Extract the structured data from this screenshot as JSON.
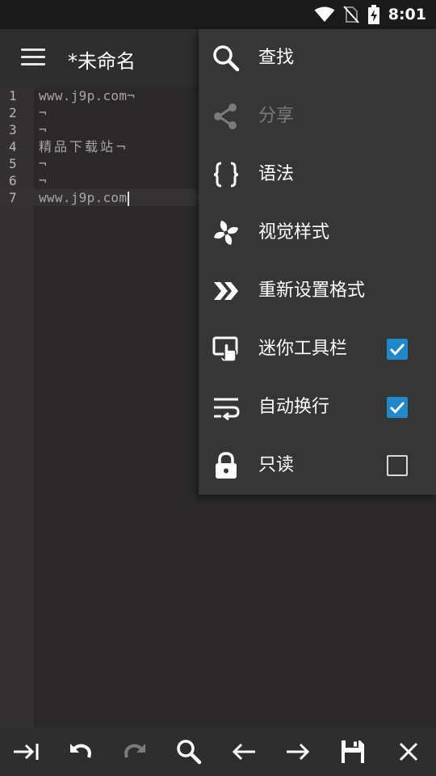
{
  "status_bar": {
    "time": "8:01",
    "icons": [
      "wifi-icon",
      "no-sim-icon",
      "battery-charging-icon"
    ]
  },
  "app_bar": {
    "menu_icon": "hamburger-icon",
    "title": "*未命名"
  },
  "editor": {
    "lines": [
      {
        "number": "1",
        "text": "www.j9p.com¬"
      },
      {
        "number": "2",
        "text": "¬"
      },
      {
        "number": "3",
        "text": "¬"
      },
      {
        "number": "4",
        "text": "精品下载站¬"
      },
      {
        "number": "5",
        "text": "¬"
      },
      {
        "number": "6",
        "text": "¬"
      },
      {
        "number": "7",
        "text": "www.j9p.com"
      }
    ],
    "active_line": 7
  },
  "menu": {
    "items": [
      {
        "label": "查找",
        "icon": "search-icon",
        "enabled": true
      },
      {
        "label": "分享",
        "icon": "share-icon",
        "enabled": false
      },
      {
        "label": "语法",
        "icon": "braces-icon",
        "enabled": true
      },
      {
        "label": "视觉样式",
        "icon": "pinwheel-icon",
        "enabled": true
      },
      {
        "label": "重新设置格式",
        "icon": "double-chevron-icon",
        "enabled": true
      },
      {
        "label": "迷你工具栏",
        "icon": "touch-screen-icon",
        "enabled": true,
        "checked": true
      },
      {
        "label": "自动换行",
        "icon": "wrap-text-icon",
        "enabled": true,
        "checked": true
      },
      {
        "label": "只读",
        "icon": "lock-icon",
        "enabled": true,
        "checked": false
      }
    ]
  },
  "toolbar": {
    "buttons": [
      "indent-icon",
      "undo-icon",
      "redo-icon",
      "search-icon",
      "arrow-left-icon",
      "arrow-right-icon",
      "save-icon",
      "close-icon"
    ]
  },
  "colors": {
    "accent": "#1e88c8",
    "background": "#2b2929",
    "menu_background": "#373636"
  }
}
